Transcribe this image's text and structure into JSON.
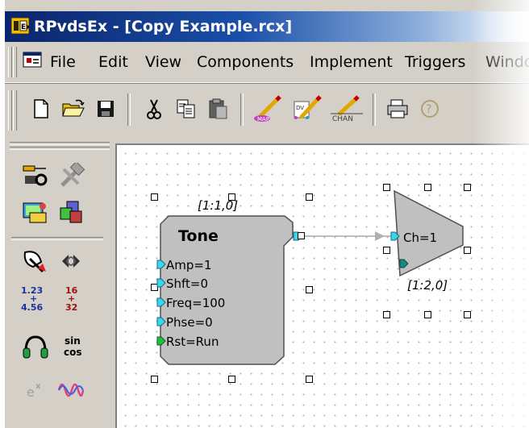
{
  "window": {
    "title": "RPvdsEx - [Copy Example.rcx]",
    "icon": "rpvdsex-app-icon"
  },
  "menubar": {
    "doc_icon": "document-window-icon",
    "items": [
      {
        "label": "File"
      },
      {
        "label": "Edit"
      },
      {
        "label": "View"
      },
      {
        "label": "Components"
      },
      {
        "label": "Implement"
      },
      {
        "label": "Triggers"
      },
      {
        "label": "Windo"
      }
    ]
  },
  "toolbar": {
    "buttons": [
      {
        "icon": "new-file-icon"
      },
      {
        "icon": "open-folder-icon"
      },
      {
        "icon": "save-disk-icon"
      },
      {
        "icon": "cut-scissors-icon"
      },
      {
        "icon": "copy-icon"
      },
      {
        "icon": "paste-icon"
      },
      {
        "icon": "edit-map-icon",
        "label": "MAP"
      },
      {
        "icon": "edit-device-icon",
        "label": "DV"
      },
      {
        "icon": "edit-chan-icon",
        "label": "CHAN"
      },
      {
        "icon": "print-icon"
      }
    ]
  },
  "palette": {
    "buttons": [
      {
        "icon": "connector-tools-icon"
      },
      {
        "icon": "hammer-tools-icon"
      },
      {
        "icon": "display-components-icon"
      },
      {
        "icon": "cubes-icon"
      },
      {
        "icon": "satellite-dish-icon"
      },
      {
        "icon": "wave-arrows-icon"
      },
      {
        "icon": "arithmetic-icon",
        "label": "1.23\n+\n4.56"
      },
      {
        "icon": "integer-arithmetic-icon",
        "label": "16\n+\n32"
      },
      {
        "icon": "headphones-icon"
      },
      {
        "icon": "sin-cos-icon",
        "label": "sin\ncos"
      },
      {
        "icon": "exponent-icon",
        "label": "e"
      },
      {
        "icon": "waveform-icon"
      }
    ]
  },
  "canvas": {
    "tone": {
      "id": "[1:1,0]",
      "title": "Tone",
      "ports": [
        "Amp=1",
        "Shft=0",
        "Freq=100",
        "Phse=0",
        "Rst=Run"
      ]
    },
    "dac": {
      "id": "[1:2,0]",
      "port": "Ch=1"
    }
  },
  "colors": {
    "title_start": "#0a246a",
    "title_end": "#a6caf0",
    "port_cyan": "#38d8e8",
    "port_green": "#20c040",
    "component_fill": "#c0c0c0"
  }
}
